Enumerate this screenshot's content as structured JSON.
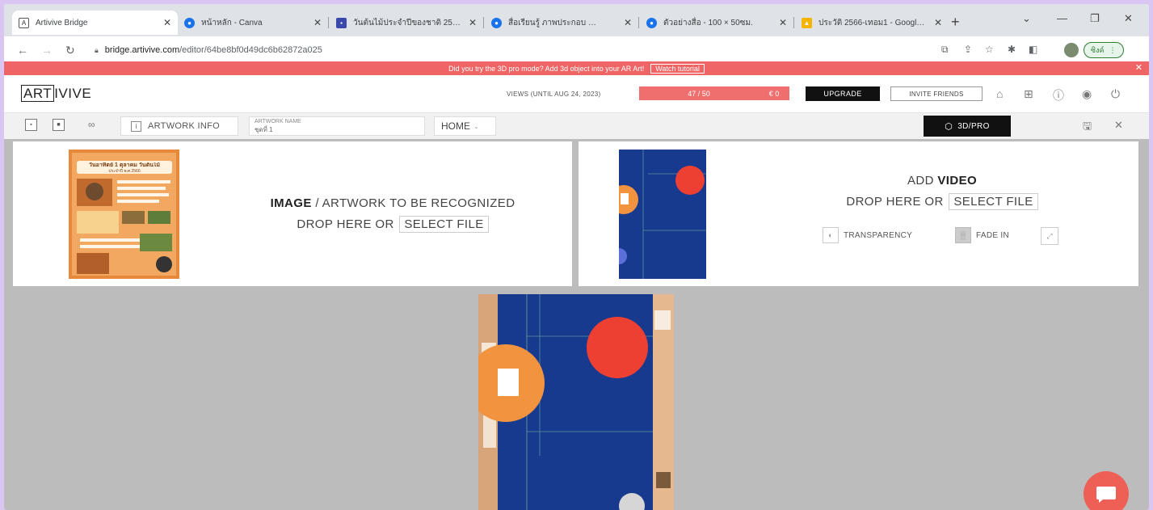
{
  "browser": {
    "tabs": [
      {
        "title": "Artivive Bridge",
        "active": true,
        "favicon_color": "#ffffff"
      },
      {
        "title": "หน้าหลัก - Canva",
        "active": false,
        "favicon_color": "#1a73e8"
      },
      {
        "title": "วันต้นไม้ประจำปีของชาติ 256…",
        "active": false,
        "favicon_color": "#3949ab"
      },
      {
        "title": "สื่อเรียนรู้ ภาพประกอบ …",
        "active": false,
        "favicon_color": "#1a73e8"
      },
      {
        "title": "ตัวอย่างสื่อ - 100 × 50ซม.",
        "active": false,
        "favicon_color": "#1a73e8"
      },
      {
        "title": "ประวัติ 2566-เทอม1 - Googl…",
        "active": false,
        "favicon_color": "#f4b400"
      }
    ],
    "url_host": "bridge.artivive.com",
    "url_path": "/editor/64be8bf0d49dc6b62872a025",
    "profile_label": "ซิงค์"
  },
  "banner": {
    "text": "Did you try the 3D pro mode? Add 3d object into your AR Art!",
    "watch_label": "Watch tutorial"
  },
  "header": {
    "logo_box": "ART",
    "logo_rest": "IVIVE",
    "views_label": "VIEWS (UNTIL AUG 24, 2023)",
    "views_count": "47 / 50",
    "views_extra": "€ 0",
    "upgrade_label": "UPGRADE",
    "invite_label": "INVITE FRIENDS"
  },
  "toolbar": {
    "artwork_info_label": "ARTWORK INFO",
    "artwork_name_label": "ARTWORK NAME",
    "artwork_name_value": "ชุดที่ 1",
    "home_label": "HOME",
    "pro3d_label": "3D/PRO"
  },
  "image_panel": {
    "title_bold": "IMAGE",
    "title_rest": " / ARTWORK TO BE RECOGNIZED",
    "drop_label": "DROP HERE OR",
    "select_label": "SELECT FILE",
    "poster_title": "วันอาทิตย์ 1 ตุลาคม วันต้นไม้",
    "poster_sub": "ประจำปี พ.ศ.2566"
  },
  "video_panel": {
    "add_label": "ADD ",
    "video_bold": "VIDEO",
    "drop_label": "DROP HERE OR",
    "select_label": "SELECT FILE",
    "transparency_label": "TRANSPARENCY",
    "fade_label": "FADE IN"
  },
  "colors": {
    "accent_red": "#ef6565",
    "video_blue": "#173a8f",
    "video_orange": "#f1933f",
    "video_red": "#ee4032",
    "chat": "#ee6055"
  }
}
